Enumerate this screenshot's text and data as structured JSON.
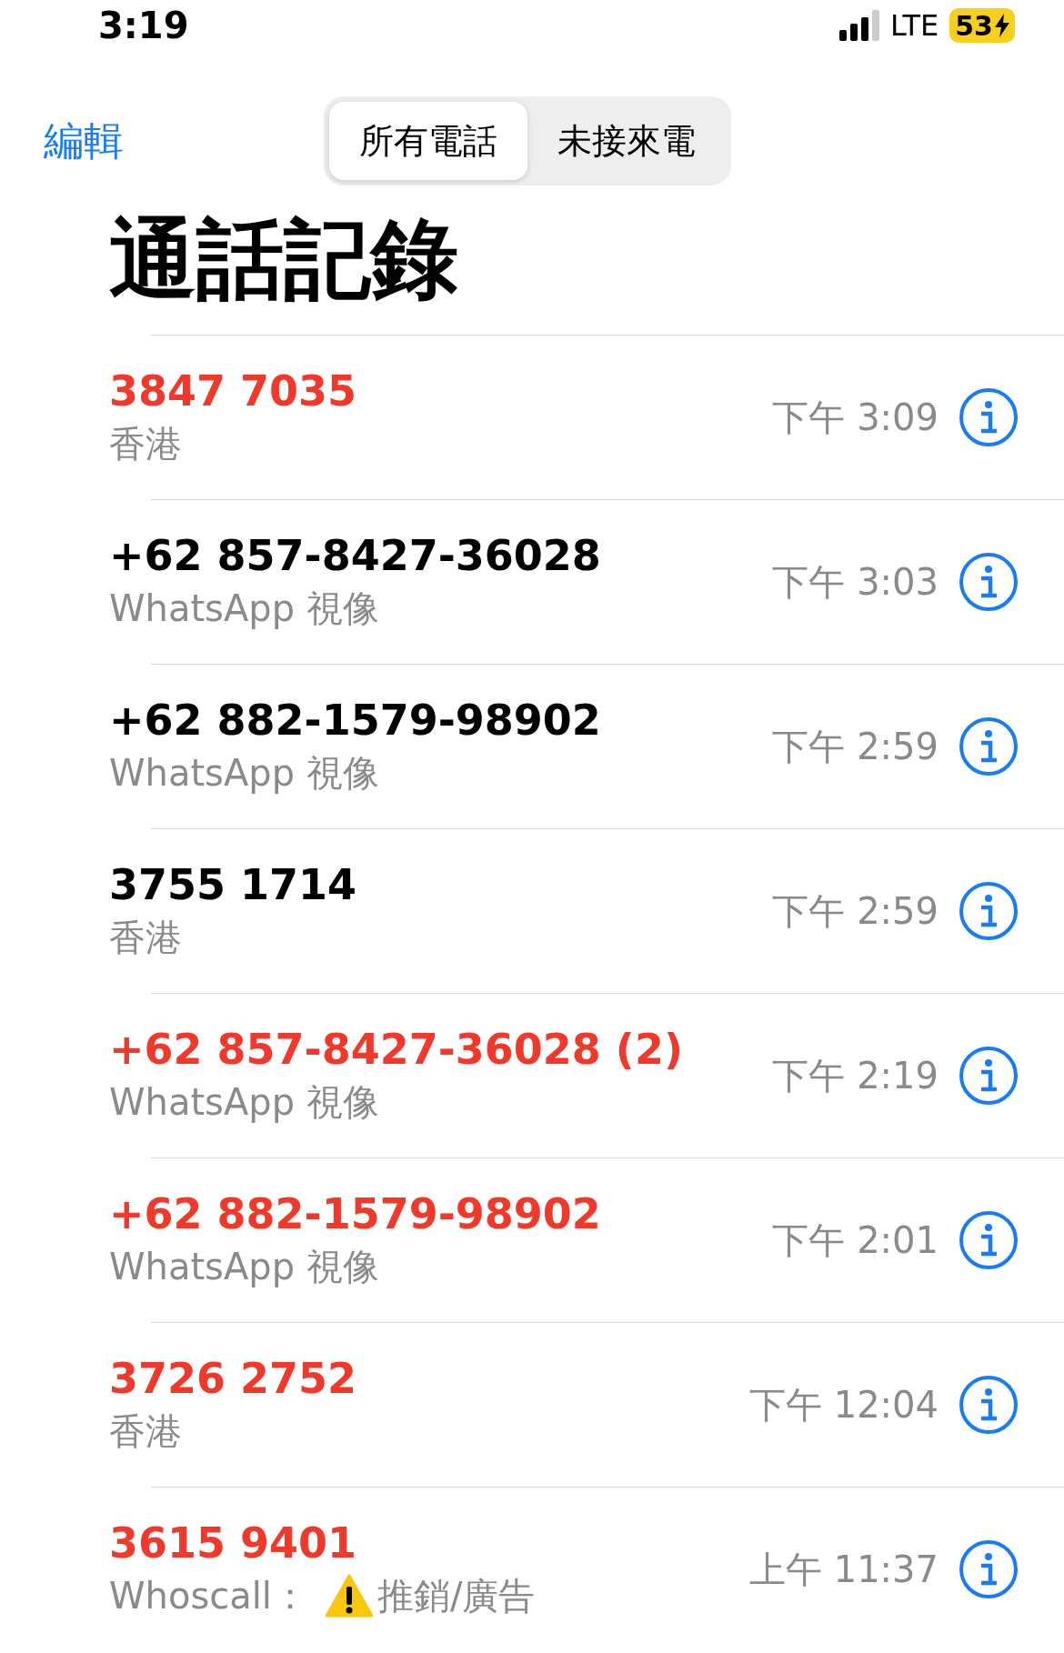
{
  "status_bar": {
    "time": "3:19",
    "network": "LTE",
    "battery": "53",
    "charging": true
  },
  "nav": {
    "edit": "編輯",
    "tabs": [
      {
        "label": "所有電話",
        "selected": true
      },
      {
        "label": "未接來電",
        "selected": false
      }
    ]
  },
  "title": "通話記錄",
  "calls": [
    {
      "name": "3847 7035",
      "missed": true,
      "subtitle": "香港",
      "time": "下午 3:09"
    },
    {
      "name": "+62 857-8427-36028",
      "missed": false,
      "subtitle": "WhatsApp 視像",
      "time": "下午 3:03"
    },
    {
      "name": "+62 882-1579-98902",
      "missed": false,
      "subtitle": "WhatsApp 視像",
      "time": "下午 2:59"
    },
    {
      "name": "3755 1714",
      "missed": false,
      "subtitle": "香港",
      "time": "下午 2:59"
    },
    {
      "name": "+62 857-8427-36028 (2)",
      "missed": true,
      "subtitle": "WhatsApp 視像",
      "time": "下午 2:19"
    },
    {
      "name": "+62 882-1579-98902",
      "missed": true,
      "subtitle": "WhatsApp 視像",
      "time": "下午 2:01"
    },
    {
      "name": "3726 2752",
      "missed": true,
      "subtitle": "香港",
      "time": "下午 12:04"
    },
    {
      "name": "3615 9401",
      "missed": true,
      "subtitle": "Whoscall：",
      "tag": "推銷/廣告",
      "time": "上午 11:37"
    }
  ]
}
